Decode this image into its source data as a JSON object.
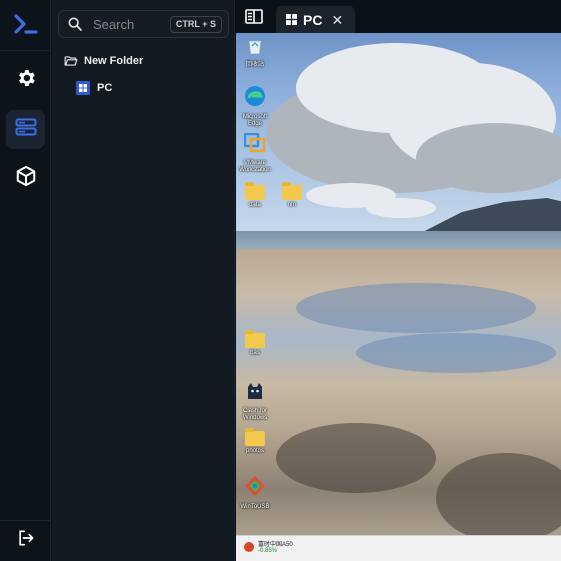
{
  "rail": {
    "items": [
      {
        "name": "terminal-logo",
        "active": false
      },
      {
        "name": "settings",
        "active": false
      },
      {
        "name": "hosts",
        "active": true
      },
      {
        "name": "packages",
        "active": false
      }
    ],
    "logout_icon": "logout-icon"
  },
  "sidebar": {
    "search": {
      "placeholder": "Search",
      "shortcut": "CTRL + S"
    },
    "tree": [
      {
        "type": "folder",
        "label": "New Folder"
      },
      {
        "type": "host",
        "label": "PC"
      }
    ]
  },
  "tabs": [
    {
      "label": "PC",
      "icon": "windows-icon",
      "closable": true
    }
  ],
  "remote_desktop": {
    "icons": [
      {
        "label": "回收站",
        "kind": "recycle-bin"
      },
      {
        "label": "Microsoft Edge",
        "kind": "edge"
      },
      {
        "label": "VMware Workstation",
        "kind": "vmware"
      },
      {
        "label": "data",
        "kind": "folder"
      },
      {
        "label": "nm",
        "kind": "folder"
      },
      {
        "label": "bas",
        "kind": "folder"
      },
      {
        "label": "Clash for Windows",
        "kind": "clash"
      },
      {
        "label": "photos",
        "kind": "folder"
      },
      {
        "label": "WinToUSB",
        "kind": "app"
      }
    ],
    "taskbar": {
      "weather_title": "富时中国A50",
      "weather_change": "-0.85%"
    }
  },
  "colors": {
    "accent": "#2f5bd0",
    "rail_bg": "#0d131a",
    "sidebar_bg": "#121920",
    "tab_bg": "#1b232d"
  }
}
